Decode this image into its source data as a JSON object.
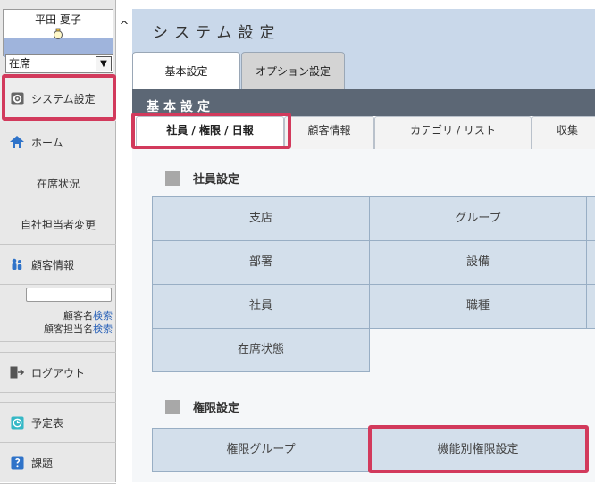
{
  "user": {
    "name": "平田 夏子"
  },
  "status": {
    "selected": "在席"
  },
  "sidebar": {
    "items": [
      {
        "label": "システム設定"
      },
      {
        "label": "ホーム"
      },
      {
        "label": "在席状況"
      },
      {
        "label": "自社担当者変更"
      },
      {
        "label": "顧客情報"
      },
      {
        "label": "ログアウト"
      },
      {
        "label": "予定表"
      },
      {
        "label": "課題"
      }
    ],
    "search": {
      "row1_label": "顧客名",
      "row2_label": "顧客担当名",
      "link": "検索"
    }
  },
  "header": {
    "title": "システム設定"
  },
  "tabs": [
    {
      "label": "基本設定"
    },
    {
      "label": "オプション設定"
    }
  ],
  "section": {
    "title": "基本設定"
  },
  "subtabs": [
    {
      "label": "社員 / 権限 / 日報"
    },
    {
      "label": "顧客情報"
    },
    {
      "label": "カテゴリ / リスト"
    },
    {
      "label": "収集"
    }
  ],
  "groups": [
    {
      "title": "社員設定",
      "cells": [
        "支店",
        "グループ",
        "部署",
        "設備",
        "社員",
        "職種",
        "在席状態"
      ]
    },
    {
      "title": "権限設定",
      "cells": [
        "権限グループ",
        "機能別権限設定"
      ]
    }
  ],
  "colors": {
    "highlight": "#d23a5c",
    "header_bg": "#c9d8ea",
    "section_bar": "#5c6775",
    "cell_bg": "#d3dfeb"
  }
}
